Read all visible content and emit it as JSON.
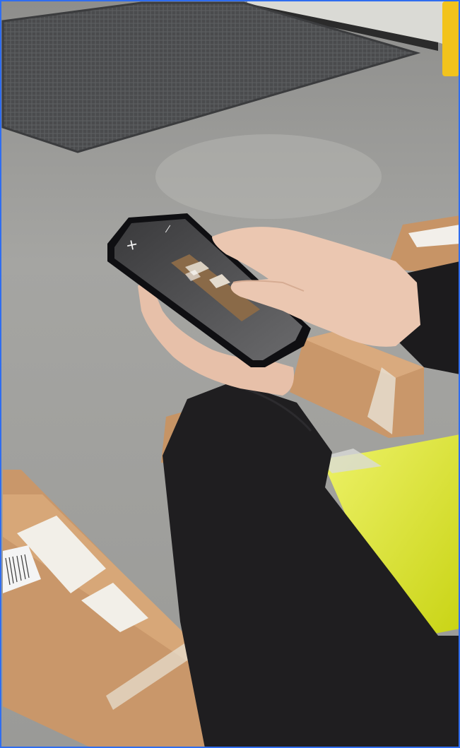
{
  "scene": {
    "colors": {
      "floor": "#a3a3a0",
      "floor_dark": "#8b8b88",
      "wall": "#d9d9d4",
      "grate": "#4c4d4e",
      "box": "#c9986a",
      "box_shadow": "#a8774f",
      "label": "#f1efe9",
      "sleeve": "#1e1d1f",
      "vest": "#d6e01a",
      "skin": "#e9c3ad",
      "phone": "#0f0f12",
      "bollard": "#f3c21b",
      "border": "#2f6df0"
    },
    "icons": {
      "close": "close-icon",
      "flash": "flash-icon"
    }
  }
}
